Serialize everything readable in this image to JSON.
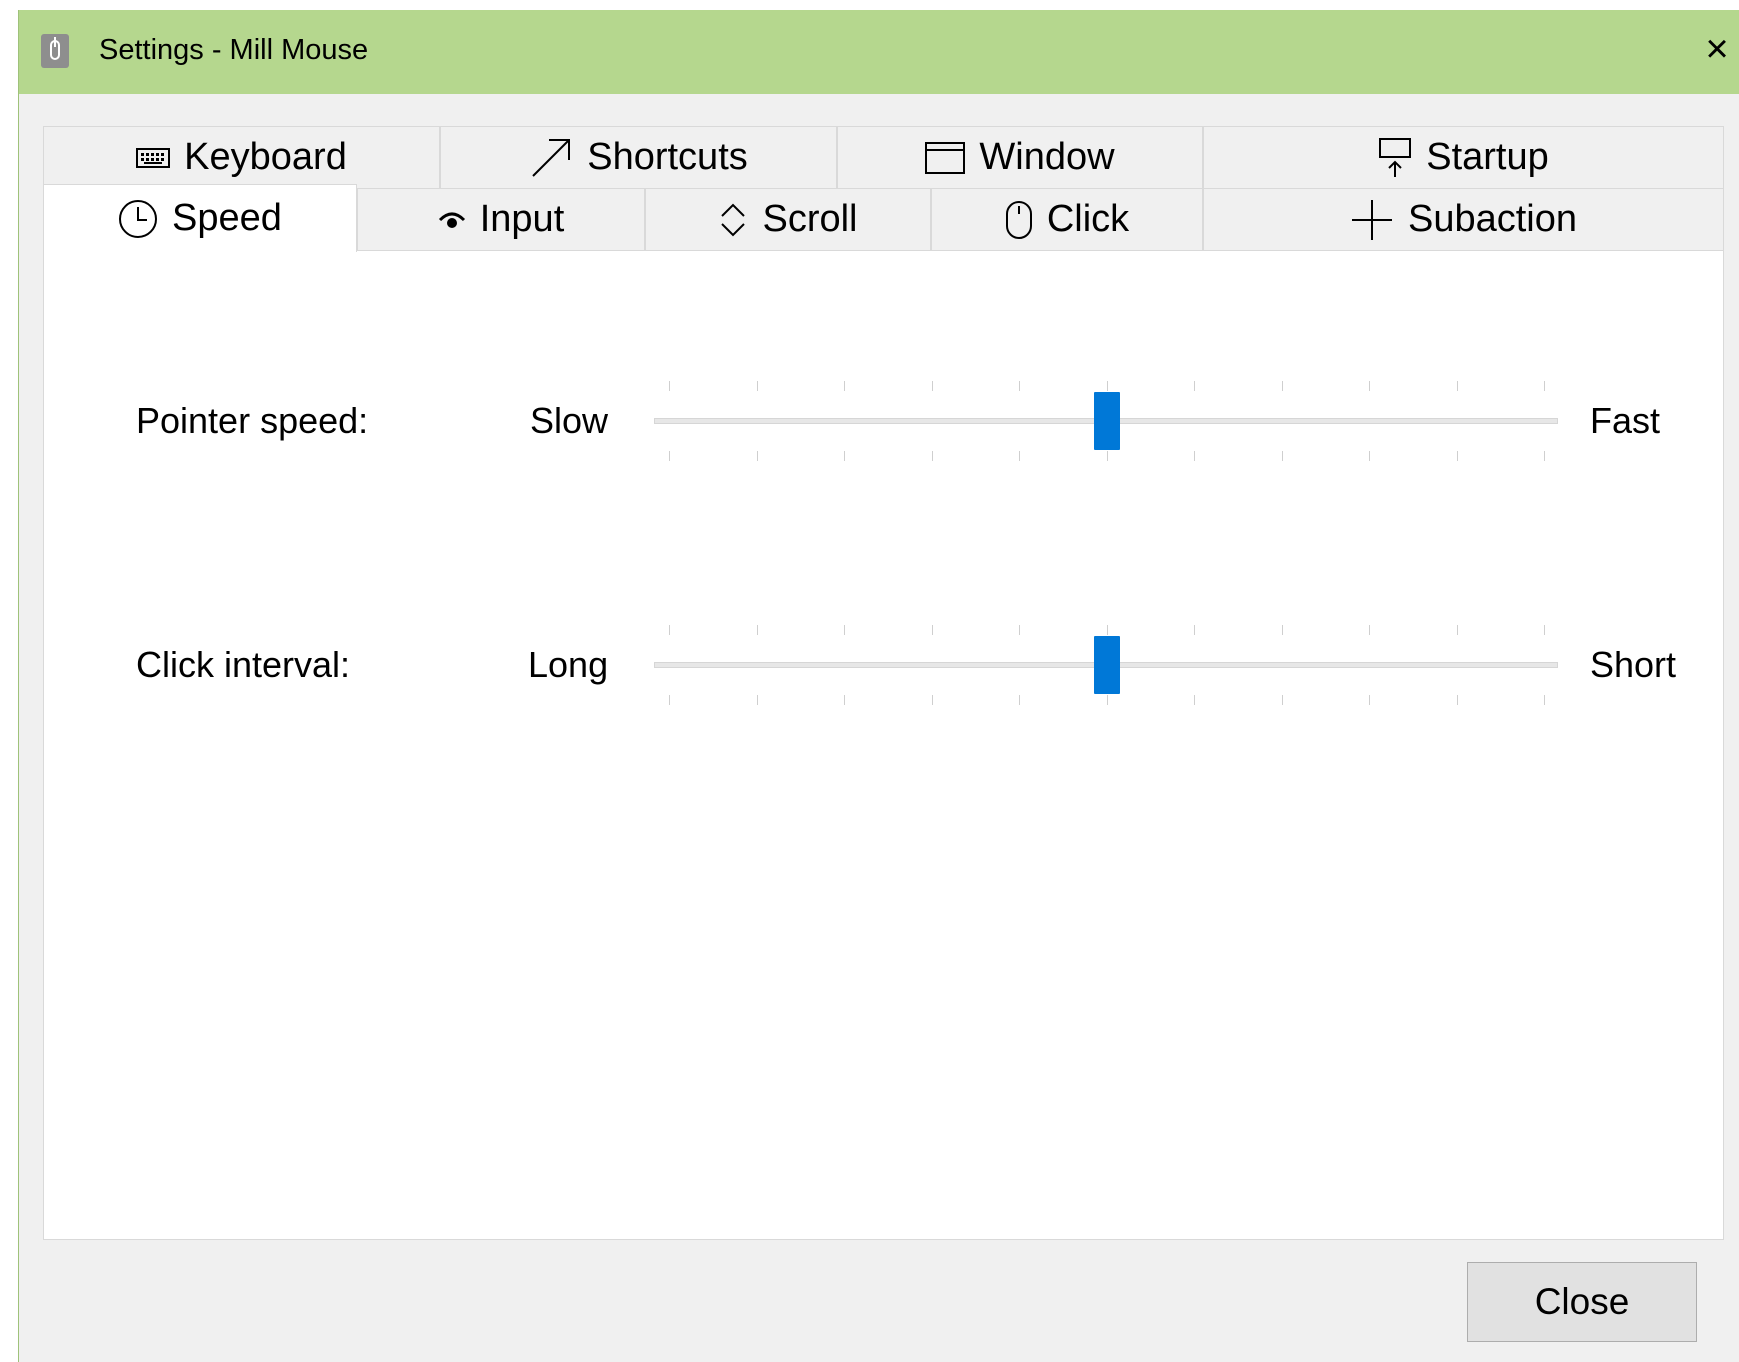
{
  "window": {
    "title": "Settings - Mill Mouse",
    "close_glyph": "×",
    "icon": "mouse-app-icon",
    "title_bar_color": "#b5d78e"
  },
  "tabs_top": [
    {
      "label": "Keyboard",
      "icon": "keyboard-icon"
    },
    {
      "label": "Shortcuts",
      "icon": "arrow-up-right-icon"
    },
    {
      "label": "Window",
      "icon": "window-icon"
    },
    {
      "label": "Startup",
      "icon": "startup-icon"
    }
  ],
  "tabs_bottom": [
    {
      "label": "Speed",
      "icon": "clock-icon",
      "active": true
    },
    {
      "label": "Input",
      "icon": "input-icon"
    },
    {
      "label": "Scroll",
      "icon": "scroll-icon"
    },
    {
      "label": "Click",
      "icon": "mouse-icon"
    },
    {
      "label": "Subaction",
      "icon": "plus-icon"
    }
  ],
  "speed_panel": {
    "pointer_speed": {
      "label": "Pointer speed:",
      "min_label": "Slow",
      "max_label": "Fast",
      "tick_count": 11,
      "value_fraction": 0.5
    },
    "click_interval": {
      "label": "Click interval:",
      "min_label": "Long",
      "max_label": "Short",
      "tick_count": 11,
      "value_fraction": 0.5
    }
  },
  "footer": {
    "close_label": "Close"
  },
  "colors": {
    "accent": "#0078d7",
    "panel_bg": "#ffffff",
    "window_bg": "#f0f0f0"
  }
}
